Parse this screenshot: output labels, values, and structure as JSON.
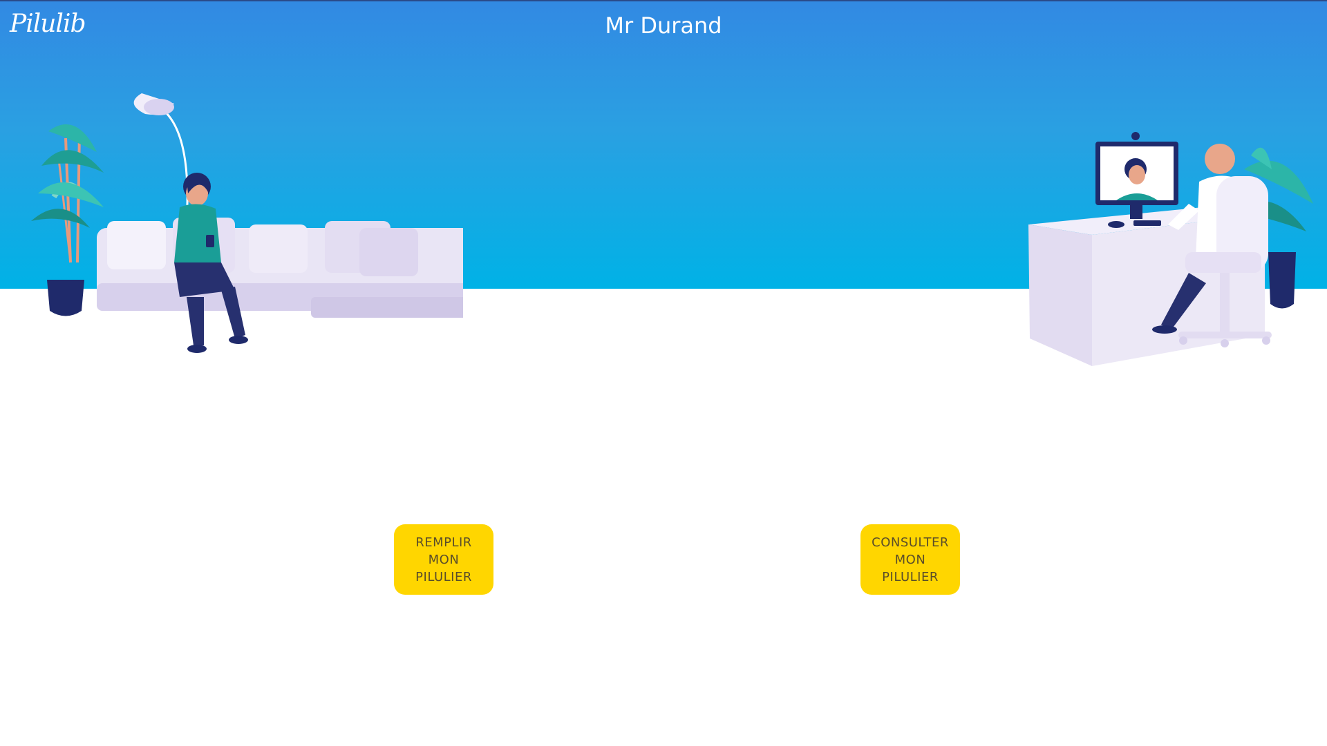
{
  "header": {
    "logo_text": "Pilulib",
    "title": "Mr Durand"
  },
  "colors": {
    "hero_top": "#3289e3",
    "hero_bottom": "#00b2e6",
    "button_yellow": "#ffd600",
    "button_text": "#5a4d2a"
  },
  "illustrations": {
    "left": "woman-on-sofa-illustration",
    "right": "doctor-teleconsultation-illustration"
  },
  "actions": {
    "fill_label": "REMPLIR\nMON\nPILULIER",
    "view_label": "CONSULTER\nMON\nPILULIER"
  }
}
